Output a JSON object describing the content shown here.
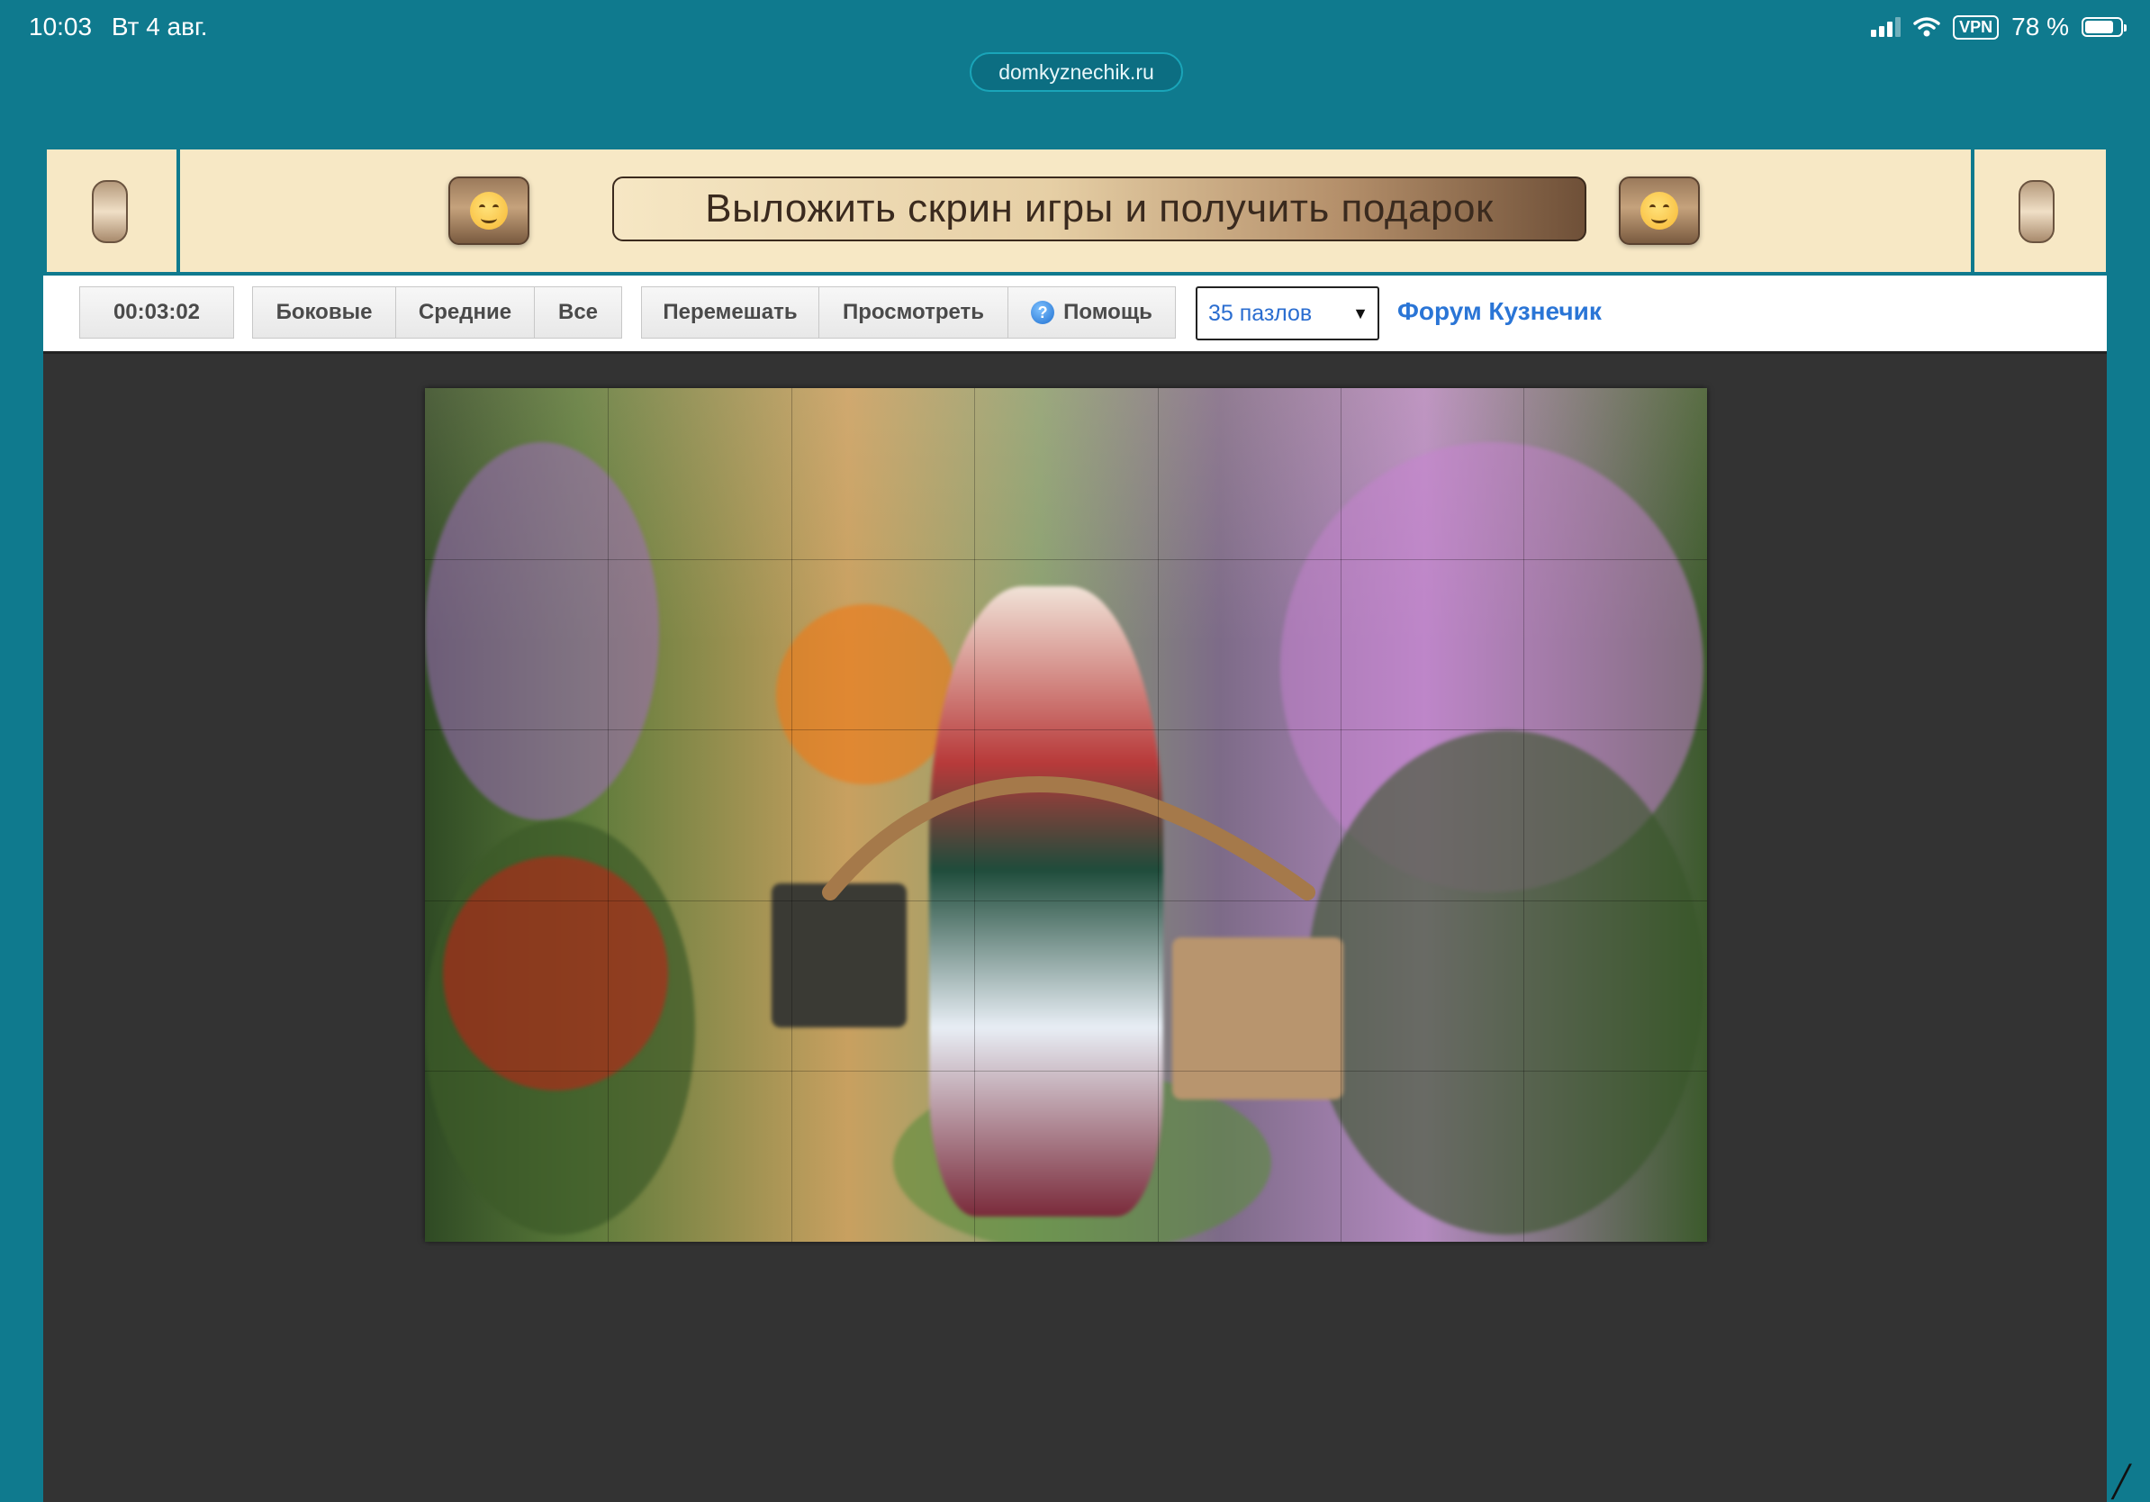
{
  "status_bar": {
    "time": "10:03",
    "date": "Вт 4 авг.",
    "vpn": "VPN",
    "battery": "78 %",
    "icons": [
      "cellular-signal-icon",
      "wifi-icon",
      "battery-icon"
    ]
  },
  "browser": {
    "url": "domkyznechik.ru"
  },
  "banner": {
    "cta_label": "Выложить скрин игры и получить подарок",
    "emoji_icon": "hugging-face-emoji-icon"
  },
  "toolbar": {
    "timer": "00:03:02",
    "filter_buttons": [
      "Боковые",
      "Средние",
      "Все"
    ],
    "shuffle_label": "Перемешать",
    "preview_label": "Просмотреть",
    "help_label": "Помощь",
    "help_icon": "question-icon",
    "pieces_select": {
      "selected": "35 пазлов"
    },
    "forum_link": "Форум Кузнечик"
  },
  "puzzle": {
    "columns": 7,
    "rows": 5,
    "image_description_icon": "puzzle-image"
  },
  "colors": {
    "page_background": "#0f7a8e",
    "banner_background": "#f7e8c5",
    "game_background": "#333333",
    "link_blue": "#2a75d6"
  }
}
